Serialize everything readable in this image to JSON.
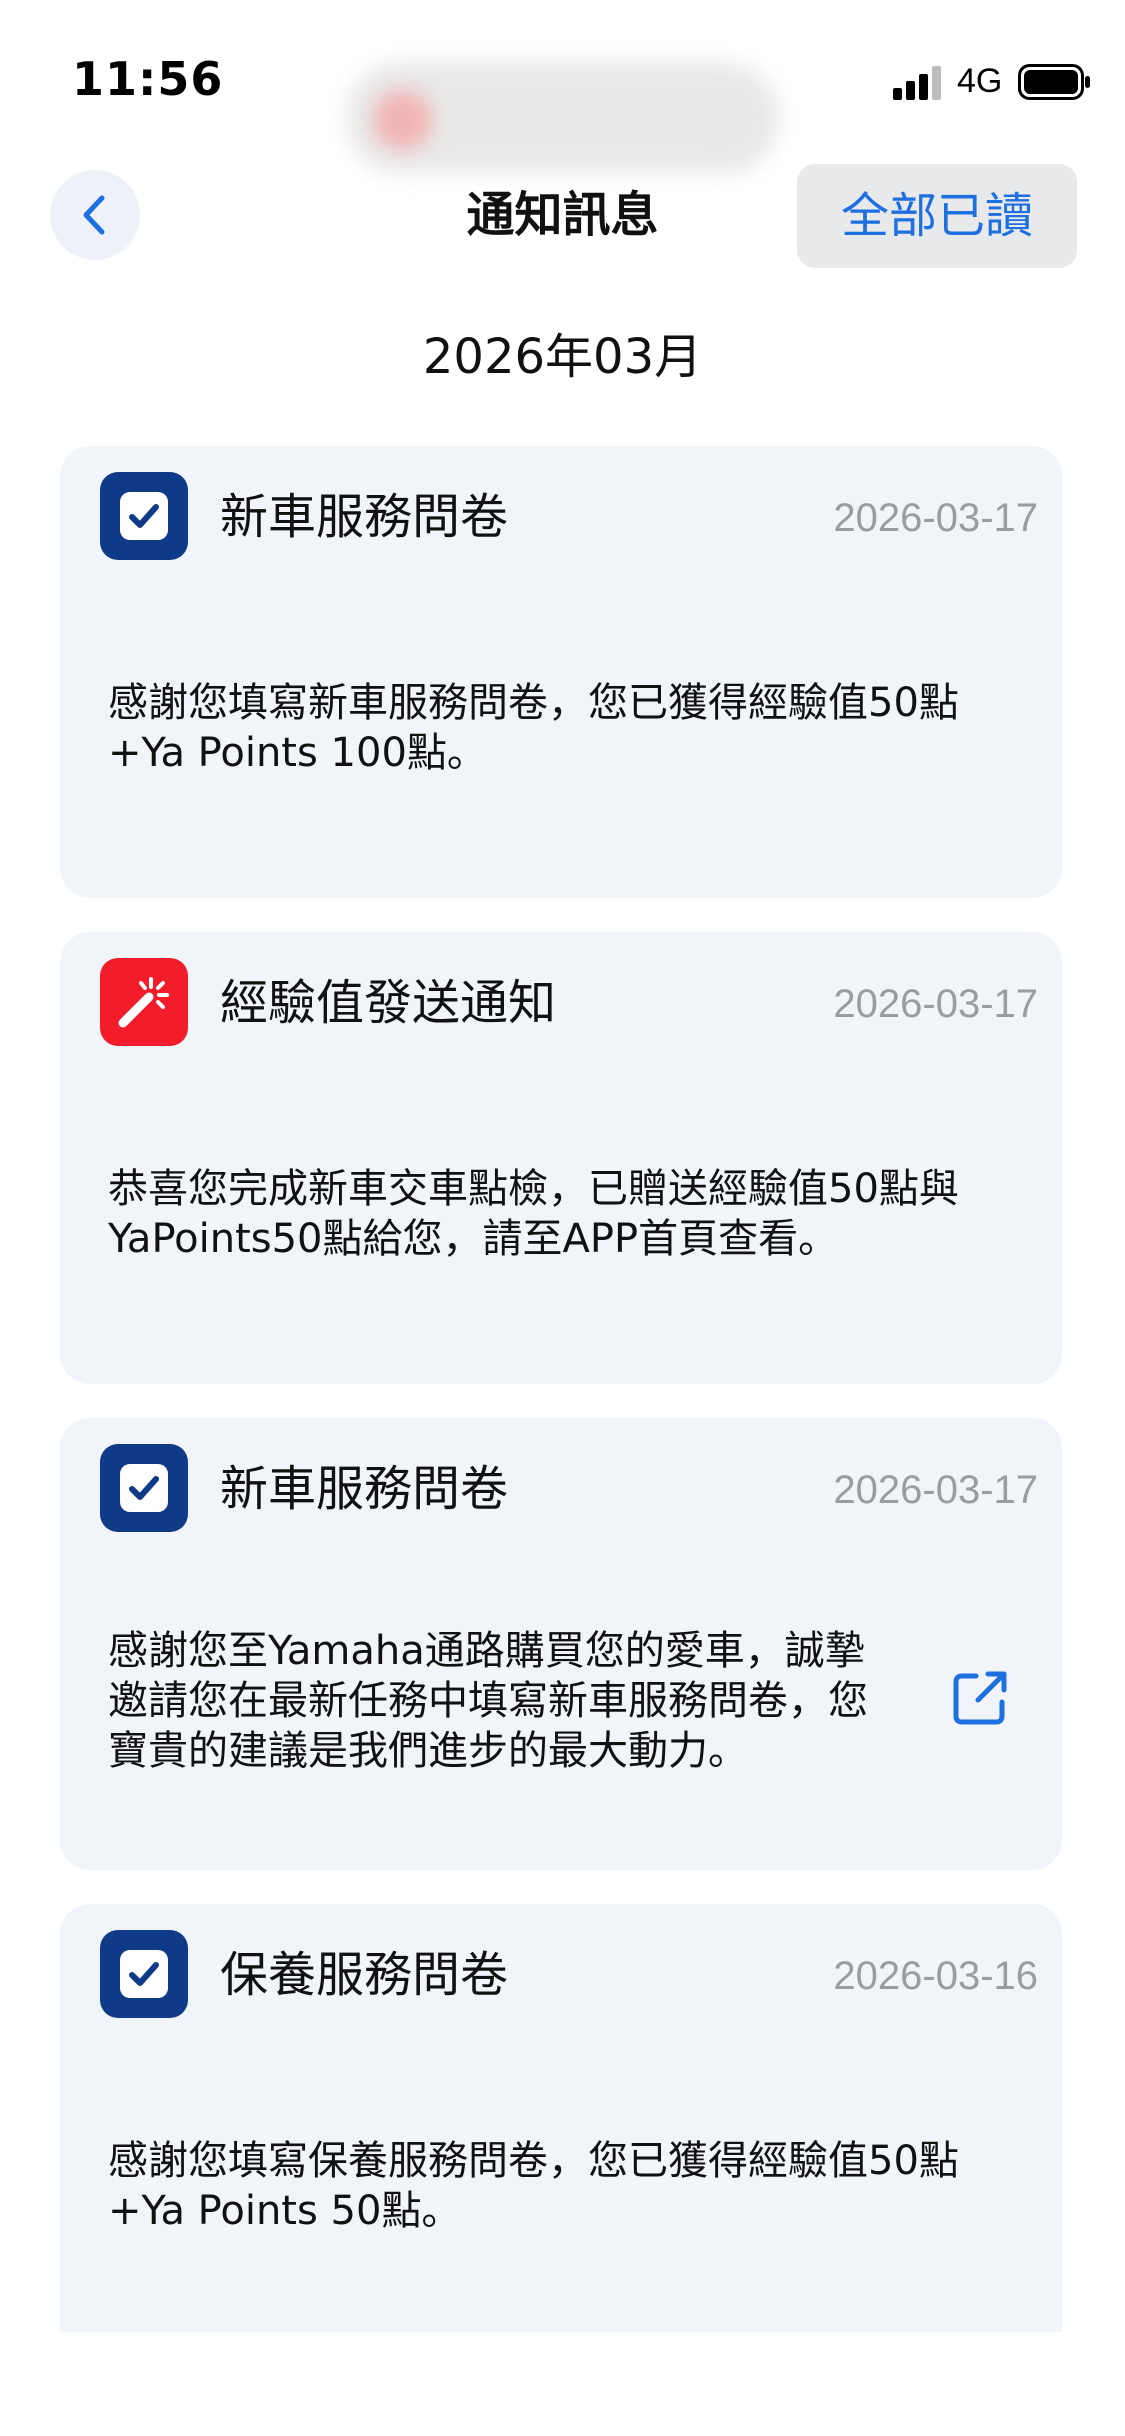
{
  "status_bar": {
    "time": "11:56",
    "network": "4G",
    "icons": [
      "cellular-signal-icon",
      "battery-icon"
    ]
  },
  "header": {
    "back_icon": "chevron-left-icon",
    "title": "通知訊息",
    "mark_all_read_label": "全部已讀"
  },
  "month_header": "2026年03月",
  "colors": {
    "accent": "#1e6fe0",
    "card_bg": "#f1f4f9",
    "survey_icon_bg": "#0e3a87",
    "exp_icon_bg": "#f21c2a",
    "date_text": "#9a9ca2"
  },
  "notifications": [
    {
      "icon": "checkbox-icon",
      "title": "新車服務問卷",
      "date": "2026-03-17",
      "body": "感謝您填寫新車服務問卷，您已獲得經驗值50點\n+Ya Points 100點。",
      "has_link": false
    },
    {
      "icon": "magic-wand-icon",
      "title": "經驗值發送通知",
      "date": "2026-03-17",
      "body": "恭喜您完成新車交車點檢，已贈送經驗值50點與\nYaPoints50點給您，請至APP首頁查看。",
      "has_link": false
    },
    {
      "icon": "checkbox-icon",
      "title": "新車服務問卷",
      "date": "2026-03-17",
      "body": "感謝您至Yamaha通路購買您的愛車，誠摯\n邀請您在最新任務中填寫新車服務問卷，您\n寶貴的建議是我們進步的最大動力。",
      "has_link": true,
      "link_icon": "external-link-icon"
    },
    {
      "icon": "checkbox-icon",
      "title": "保養服務問卷",
      "date": "2026-03-16",
      "body": "感謝您填寫保養服務問卷，您已獲得經驗值50點\n+Ya Points 50點。",
      "has_link": false
    }
  ]
}
